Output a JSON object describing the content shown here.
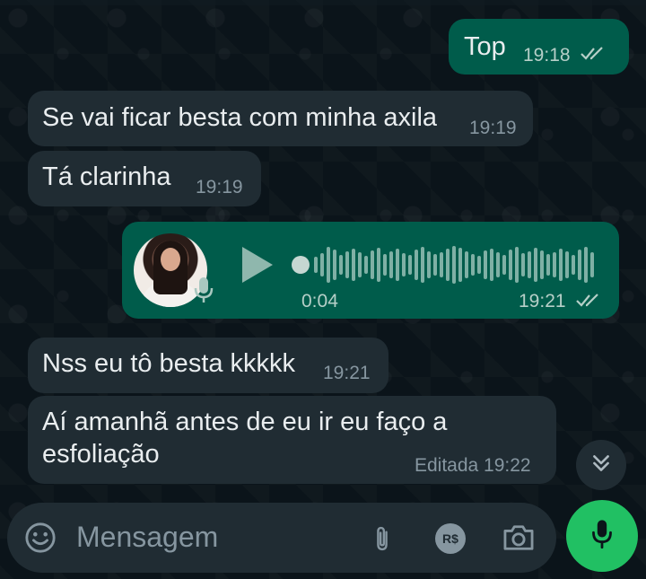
{
  "messages": [
    {
      "direction": "out",
      "text": "Top",
      "time": "19:18",
      "status": "read"
    },
    {
      "direction": "in",
      "text": "Se vai ficar besta com minha axila",
      "time": "19:19"
    },
    {
      "direction": "in",
      "text": "Tá clarinha",
      "time": "19:19"
    },
    {
      "direction": "out",
      "type": "voice",
      "duration": "0:04",
      "time": "19:21",
      "status": "read"
    },
    {
      "direction": "in",
      "text": "Nss eu tô besta kkkkk",
      "time": "19:21"
    },
    {
      "direction": "in",
      "text_lines": [
        "Aí amanhã antes de eu ir eu faço a",
        "esfoliação"
      ],
      "edited_time": "Editada 19:22"
    }
  ],
  "composer": {
    "placeholder": "Mensagem",
    "payment_label": "R$"
  },
  "icons": {
    "emoji": "emoji-icon",
    "attach": "paperclip-icon",
    "payment": "payment-icon",
    "camera": "camera-icon",
    "mic": "mic-icon",
    "scroll_down": "double-chevron-down-icon",
    "read_receipt": "double-check-icon",
    "play": "play-icon"
  },
  "colors": {
    "background": "#0b141a",
    "incoming_bubble": "#202c33",
    "outgoing_bubble": "#005c4b",
    "accent_green": "#21c063",
    "meta_text": "#8696a0"
  }
}
